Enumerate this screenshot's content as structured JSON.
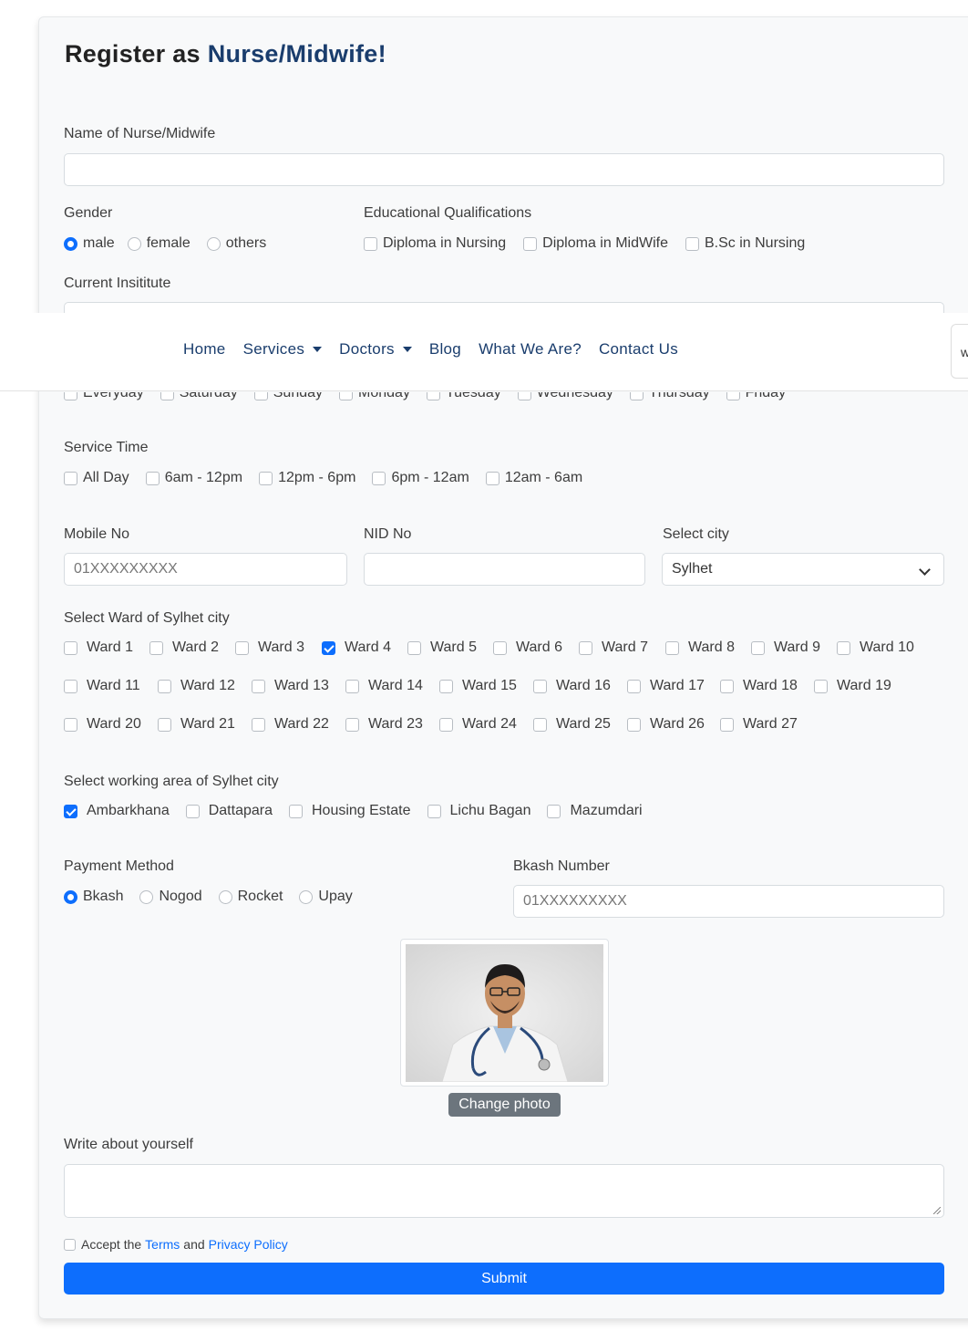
{
  "form": {
    "title_prefix": "Register as ",
    "title_accent": "Nurse/Midwife!",
    "name_label": "Name of Nurse/Midwife",
    "name_value": "",
    "gender_label": "Gender",
    "gender_options": [
      "male",
      "female",
      "others"
    ],
    "gender_selected": "male",
    "edu_label": "Educational Qualifications",
    "edu_options": [
      "Diploma in Nursing",
      "Diploma in MidWife",
      "B.Sc in Nursing"
    ],
    "institute_label": "Current Insititute",
    "days": [
      "Everyday",
      "Saturday",
      "Sunday",
      "Monday",
      "Tuesday",
      "Wednesday",
      "Thursday",
      "Friday"
    ],
    "service_time_label": "Service Time",
    "service_time_options": [
      "All Day",
      "6am - 12pm",
      "12pm - 6pm",
      "6pm - 12am",
      "12am - 6am"
    ],
    "mobile_label": "Mobile No",
    "mobile_placeholder": "01XXXXXXXXX",
    "nid_label": "NID No",
    "city_label": "Select city",
    "city_value": "Sylhet",
    "ward_label": "Select Ward of Sylhet city",
    "wards": [
      "Ward 1",
      "Ward 2",
      "Ward 3",
      "Ward 4",
      "Ward 5",
      "Ward 6",
      "Ward 7",
      "Ward 8",
      "Ward 9",
      "Ward 10",
      "Ward 11",
      "Ward 12",
      "Ward 13",
      "Ward 14",
      "Ward 15",
      "Ward 16",
      "Ward 17",
      "Ward 18",
      "Ward 19",
      "Ward 20",
      "Ward 21",
      "Ward 22",
      "Ward 23",
      "Ward 24",
      "Ward 25",
      "Ward 26",
      "Ward 27"
    ],
    "ward_checked": "Ward 4",
    "area_label": "Select working area of Sylhet city",
    "areas": [
      "Ambarkhana",
      "Dattapara",
      "Housing Estate",
      "Lichu Bagan",
      "Mazumdari"
    ],
    "area_checked": "Ambarkhana",
    "payment_label": "Payment Method",
    "payment_options": [
      "Bkash",
      "Nogod",
      "Rocket",
      "Upay"
    ],
    "payment_selected": "Bkash",
    "bkash_label": "Bkash Number",
    "bkash_placeholder": "01XXXXXXXXX",
    "change_photo": "Change photo",
    "about_label": "Write about yourself",
    "accept_prefix": "Accept the",
    "terms": "Terms",
    "and": "and",
    "privacy": "Privacy Policy",
    "submit": "Submit"
  },
  "navbar": {
    "links": [
      "Home",
      "Services",
      "Doctors",
      "Blog",
      "What We Are?",
      "Contact Us"
    ],
    "dropdowns": [
      "Services",
      "Doctors"
    ],
    "edge_text": "w"
  },
  "colors": {
    "accent": "#0d6efd",
    "brand": "#1a3d6d",
    "secondary_button": "#6c757d"
  }
}
